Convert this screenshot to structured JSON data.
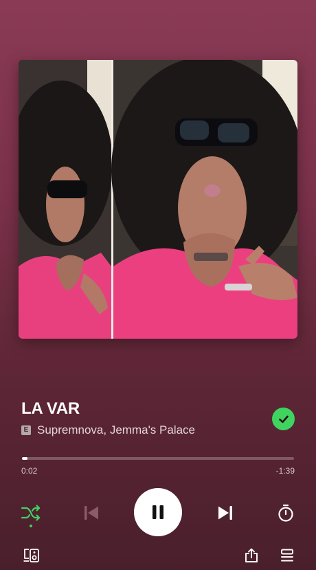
{
  "track": {
    "title": "LA VAR",
    "explicit_label": "E",
    "artists": "Supremnova, Jemma's Palace",
    "liked": true
  },
  "progress": {
    "elapsed": "0:02",
    "remaining": "-1:39",
    "fraction": 0.02
  },
  "controls": {
    "shuffle_icon": "shuffle-icon",
    "shuffle_active": true,
    "previous_icon": "skip-previous-icon",
    "play_pause_icon": "pause-icon",
    "next_icon": "skip-next-icon",
    "timer_icon": "sleep-timer-icon"
  },
  "bottom_bar": {
    "devices_icon": "connect-devices-icon",
    "share_icon": "share-icon",
    "queue_icon": "queue-icon"
  },
  "colors": {
    "accent_green": "#3fd35f",
    "background_top": "#8a3a55",
    "background_bottom": "#4a1f2c"
  }
}
